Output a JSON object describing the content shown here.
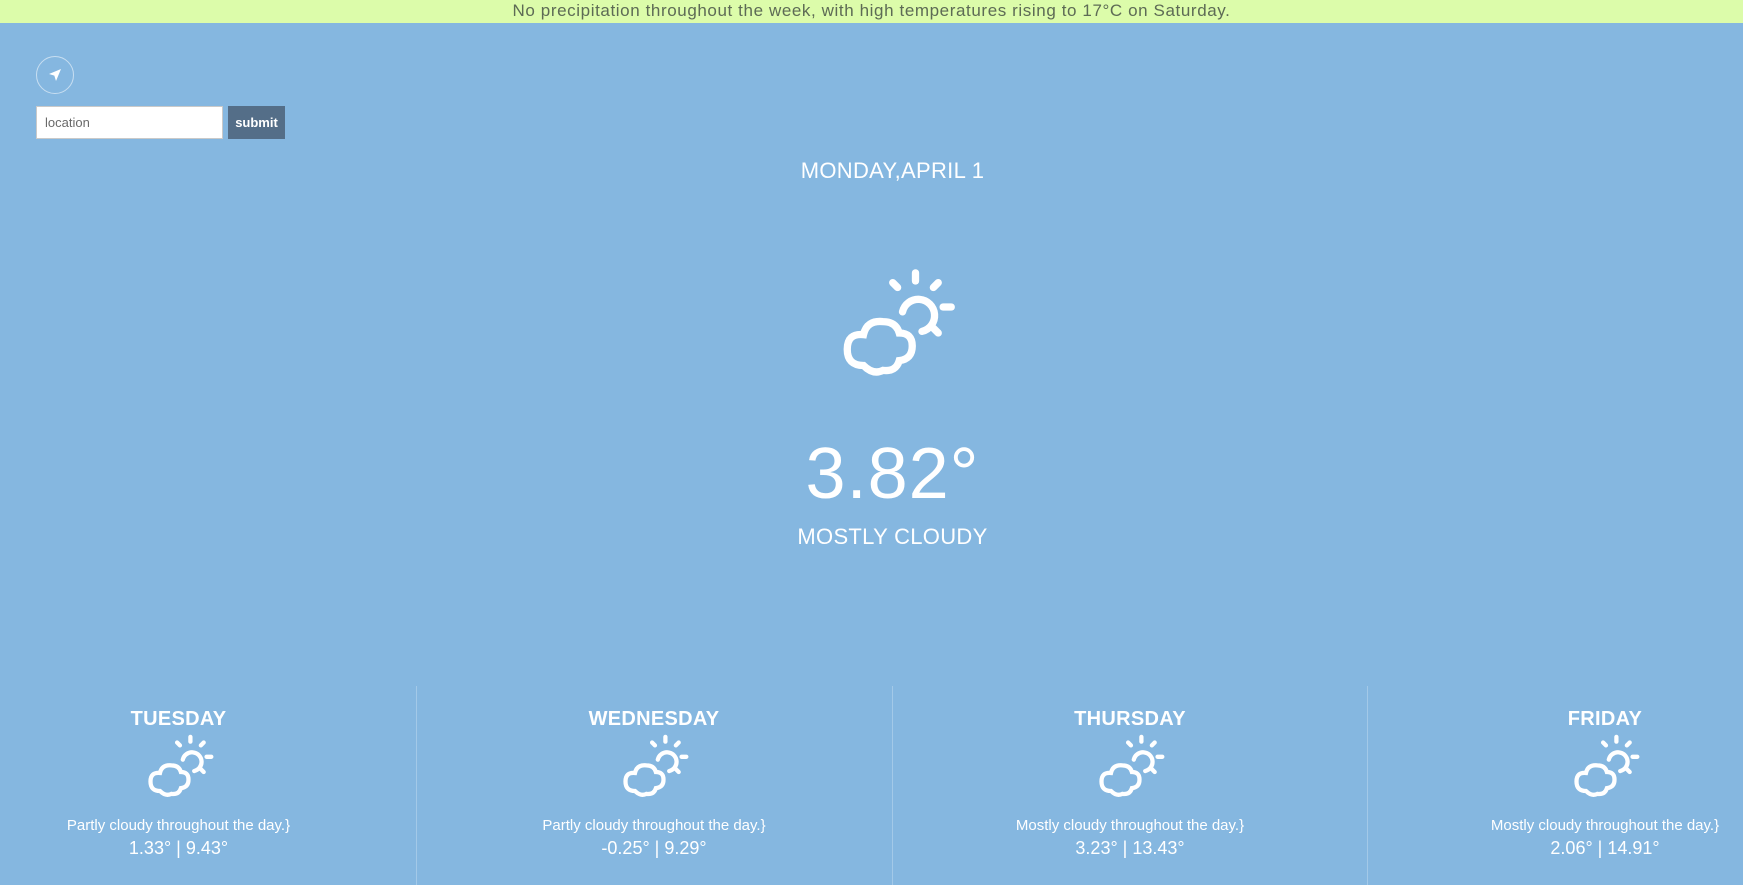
{
  "banner": {
    "text": "No precipitation throughout the week, with high temperatures rising to 17°C on Saturday."
  },
  "search": {
    "placeholder": "location",
    "submit_label": "submit"
  },
  "current": {
    "date": "MONDAY,APRIL 1",
    "temperature": "3.82°",
    "condition": "MOSTLY CLOUDY",
    "icon": "partly-cloudy-icon"
  },
  "forecast": [
    {
      "day": "TUESDAY",
      "summary": "Partly cloudy throughout the day.}",
      "range": "1.33° | 9.43°",
      "icon": "partly-cloudy-icon"
    },
    {
      "day": "WEDNESDAY",
      "summary": "Partly cloudy throughout the day.}",
      "range": "-0.25° | 9.29°",
      "icon": "partly-cloudy-icon"
    },
    {
      "day": "THURSDAY",
      "summary": "Mostly cloudy throughout the day.}",
      "range": "3.23° | 13.43°",
      "icon": "partly-cloudy-icon"
    },
    {
      "day": "FRIDAY",
      "summary": "Mostly cloudy throughout the day.}",
      "range": "2.06° | 14.91°",
      "icon": "partly-cloudy-icon"
    }
  ],
  "colors": {
    "background": "#85b7e0",
    "banner_bg": "#dcfcaa",
    "submit_bg": "#546e88"
  }
}
